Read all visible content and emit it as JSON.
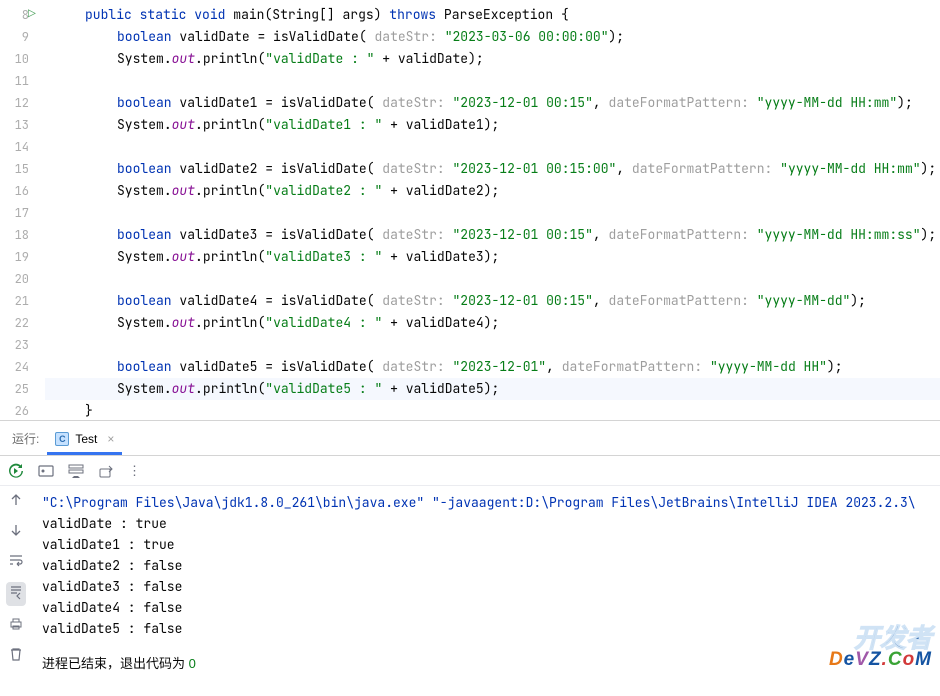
{
  "code": {
    "lines": [
      8,
      9,
      10,
      11,
      12,
      13,
      14,
      15,
      16,
      17,
      18,
      19,
      20,
      21,
      22,
      23,
      24,
      25,
      26
    ],
    "kw_public": "public",
    "kw_static": "static",
    "kw_void": "void",
    "kw_boolean": "boolean",
    "kw_throws": "throws",
    "main": "main",
    "string_args": "String[] args",
    "parse_exc": "ParseException",
    "system": "System",
    "out": "out",
    "println": "println",
    "isValid": "isValidDate",
    "var0": "validDate",
    "var1": "validDate1",
    "var2": "validDate2",
    "var3": "validDate3",
    "var4": "validDate4",
    "var5": "validDate5",
    "param_datestr": "dateStr:",
    "param_fmt": "dateFormatPattern:",
    "val0": "\"2023-03-06 00:00:00\"",
    "val1": "\"2023-12-01 00:15\"",
    "fmt1": "\"yyyy-MM-dd HH:mm\"",
    "val2": "\"2023-12-01 00:15:00\"",
    "fmt2": "\"yyyy-MM-dd HH:mm\"",
    "val3": "\"2023-12-01 00:15\"",
    "fmt3": "\"yyyy-MM-dd HH:mm:ss\"",
    "val4": "\"2023-12-01 00:15\"",
    "fmt4": "\"yyyy-MM-dd\"",
    "val5": "\"2023-12-01\"",
    "fmt5": "\"yyyy-MM-dd HH\"",
    "p0": "\"validDate : \"",
    "p1": "\"validDate1 : \"",
    "p2": "\"validDate2 : \"",
    "p3": "\"validDate3 : \"",
    "p4": "\"validDate4 : \"",
    "p5": "\"validDate5 : \""
  },
  "tabs": {
    "run": "运行:",
    "name": "Test"
  },
  "console": {
    "cmd": "\"C:\\Program Files\\Java\\jdk1.8.0_261\\bin\\java.exe\" \"-javaagent:D:\\Program Files\\JetBrains\\IntelliJ IDEA 2023.2.3\\",
    "out": [
      "validDate : true",
      "validDate1 : true",
      "validDate2 : false",
      "validDate3 : false",
      "validDate4 : false",
      "validDate5 : false"
    ],
    "end": "进程已结束，退出代码为 ",
    "end_code": "0"
  },
  "watermark": {
    "line1": "开发者",
    "d": "D",
    "e": "e",
    "v": "V",
    "z": "Z",
    ".": ".",
    "c": "C",
    "o": "o",
    "m": "M"
  }
}
